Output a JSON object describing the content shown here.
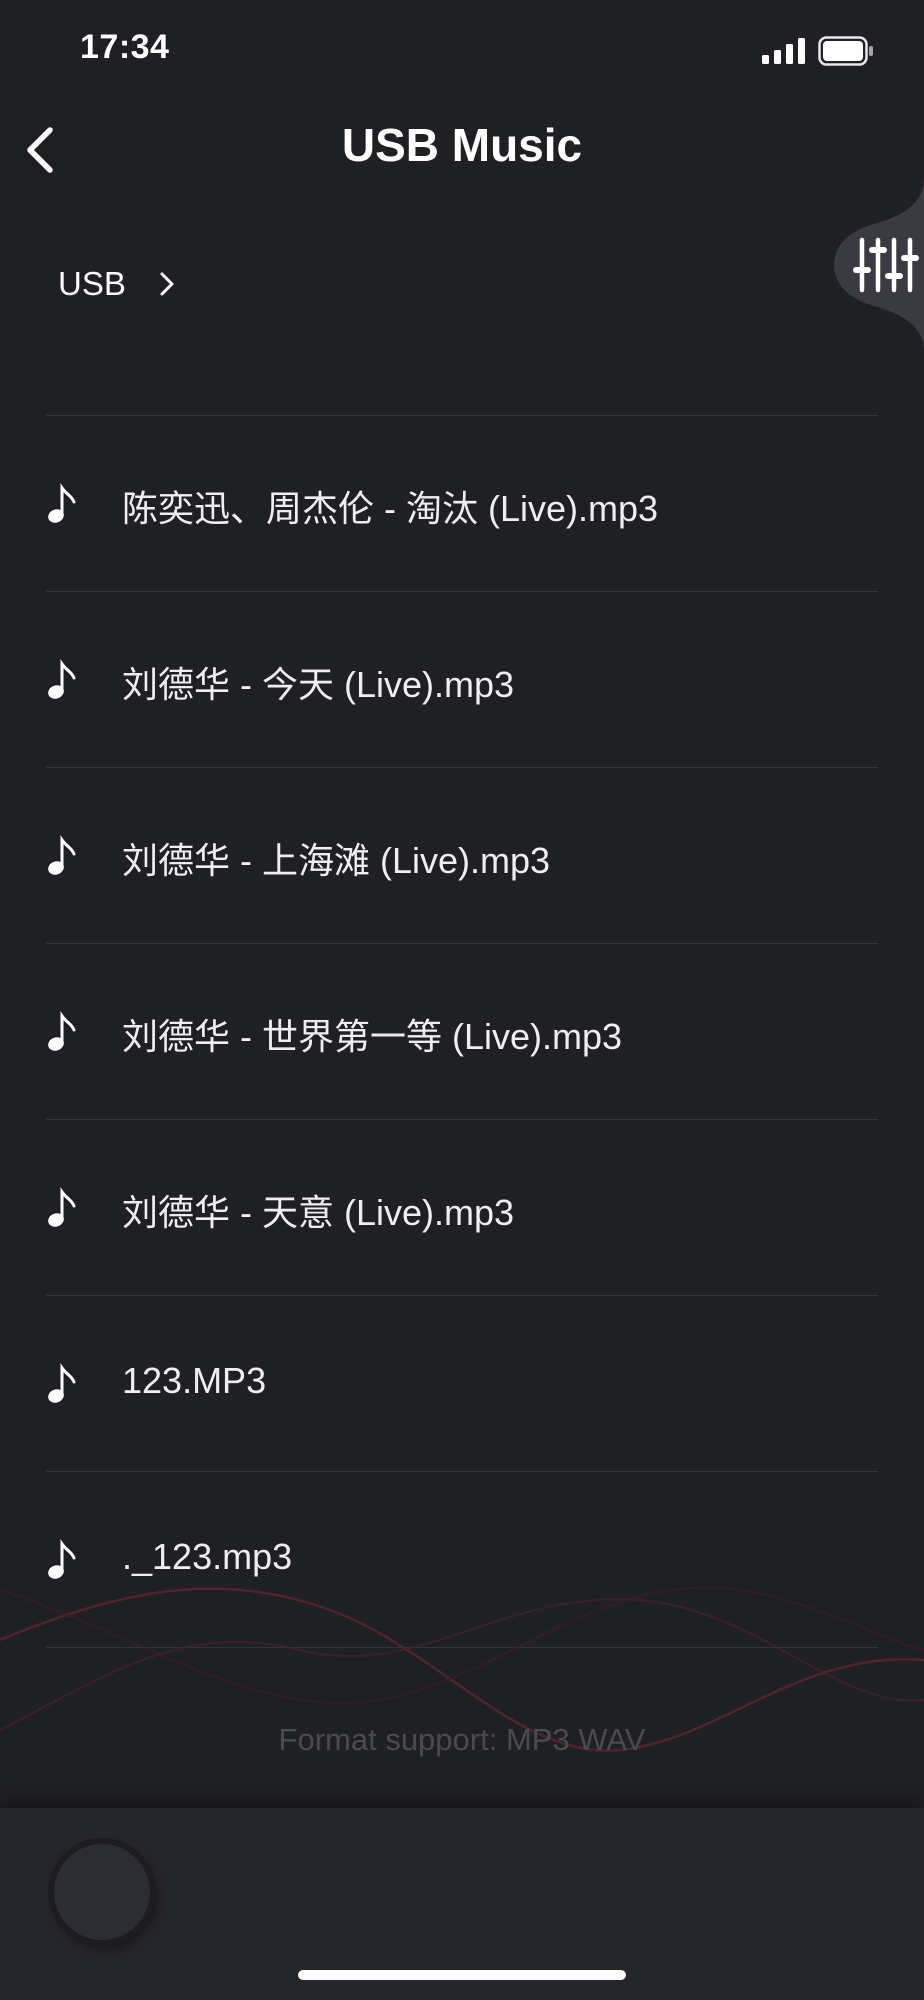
{
  "status_bar": {
    "time": "17:34"
  },
  "header": {
    "title": "USB Music",
    "back_icon": "chevron-left-icon"
  },
  "breadcrumb": {
    "label": "USB",
    "icon": "chevron-right-icon"
  },
  "equalizer_button": {
    "icon": "sliders-icon"
  },
  "files": [
    {
      "name": "陈奕迅、周杰伦 - 淘汰 (Live).mp3",
      "icon": "music-note-icon"
    },
    {
      "name": "刘德华 - 今天 (Live).mp3",
      "icon": "music-note-icon"
    },
    {
      "name": "刘德华 - 上海滩 (Live).mp3",
      "icon": "music-note-icon"
    },
    {
      "name": "刘德华 - 世界第一等 (Live).mp3",
      "icon": "music-note-icon"
    },
    {
      "name": "刘德华 - 天意 (Live).mp3",
      "icon": "music-note-icon"
    },
    {
      "name": "123.MP3",
      "icon": "music-note-icon"
    },
    {
      "name": "._123.mp3",
      "icon": "music-note-icon"
    }
  ],
  "format_note": "Format support: MP3 WAV",
  "colors": {
    "background": "#1f2024",
    "divider": "#34353b",
    "player_bar": "#25262b",
    "wave_accent": "#6b2a33"
  }
}
